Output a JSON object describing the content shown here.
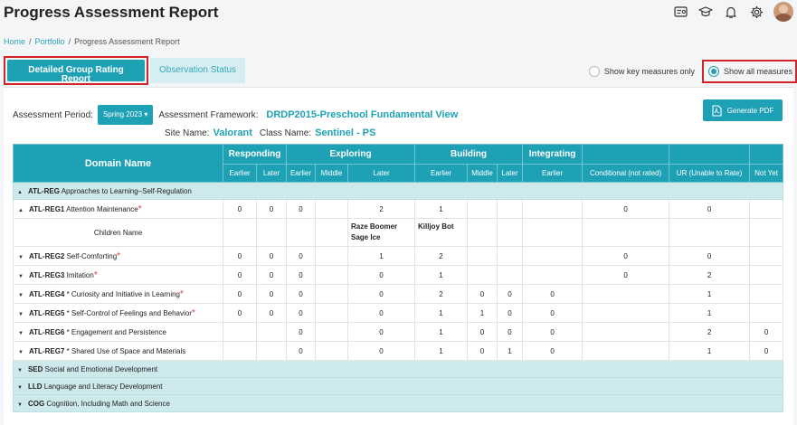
{
  "page": {
    "title": "Progress Assessment Report",
    "breadcrumb": [
      "Home",
      "Portfolio",
      "Progress Assessment Report"
    ],
    "header_icons": [
      "id-card-icon",
      "graduation-cap-icon",
      "bell-icon",
      "gear-icon"
    ]
  },
  "tabs": {
    "detailed": "Detailed Group Rating Report",
    "observation": "Observation Status"
  },
  "measures": {
    "key_only": "Show key measures only",
    "all": "Show all measures",
    "selected": "all"
  },
  "filters": {
    "period_label": "Assessment Period:",
    "period_value": "Spring 2023",
    "framework_label": "Assessment Framework:",
    "framework_value": "DRDP2015-Preschool Fundamental View",
    "site_label": "Site Name:",
    "site_value": "Valorant",
    "class_label": "Class Name:",
    "class_value": "Sentinel - PS",
    "pdf_button": "Generate PDF"
  },
  "colors": {
    "accent": "#1ea1b5",
    "highlight_box": "#d2232a",
    "required_star": "#e53935",
    "domain_row": "#cde9ec"
  },
  "table": {
    "domain_header": "Domain Name",
    "groups": [
      "Responding",
      "Exploring",
      "Building",
      "Integrating"
    ],
    "sub_headers": [
      "Earlier",
      "Later",
      "Earlier",
      "Middle",
      "Later",
      "Earlier",
      "Middle",
      "Later",
      "Earlier",
      "Conditional (not rated)",
      "UR (Unable to Rate)",
      "Not Yet"
    ],
    "domains": {
      "atl_reg": {
        "code": "ATL-REG",
        "name": "Approaches to Learning–Self-Regulation"
      },
      "sed": {
        "code": "SED",
        "name": "Social and Emotional Development"
      },
      "lld": {
        "code": "LLD",
        "name": "Language and Literacy Development"
      },
      "cog": {
        "code": "COG",
        "name": "Cognition, Including Math and Science"
      }
    },
    "children_name_label": "Children Name",
    "children_exploring_later": [
      "Raze Boomer",
      "Sage Ice"
    ],
    "children_building_earlier": [
      "Killjoy Bot"
    ],
    "rows": [
      {
        "code": "ATL-REG1",
        "name": "Attention Maintenance",
        "star": "*",
        "cells": [
          "0",
          "0",
          "0",
          "",
          "2",
          "1",
          "",
          "",
          "",
          "0",
          "0",
          ""
        ]
      },
      {
        "code": "ATL-REG2",
        "name": "Self-Comforting",
        "star": "*",
        "cells": [
          "0",
          "0",
          "0",
          "",
          "1",
          "2",
          "",
          "",
          "",
          "0",
          "0",
          ""
        ]
      },
      {
        "code": "ATL-REG3",
        "name": "Imitation",
        "star": "*",
        "cells": [
          "0",
          "0",
          "0",
          "",
          "0",
          "1",
          "",
          "",
          "",
          "0",
          "2",
          ""
        ]
      },
      {
        "code": "ATL-REG4",
        "name": "* Curiosity and Initiative in Learning",
        "star": "*",
        "cells": [
          "0",
          "0",
          "0",
          "",
          "0",
          "2",
          "0",
          "0",
          "0",
          "",
          "1",
          ""
        ]
      },
      {
        "code": "ATL-REG5",
        "name": "* Self-Control of Feelings and Behavior",
        "star": "*",
        "cells": [
          "0",
          "0",
          "0",
          "",
          "0",
          "1",
          "1",
          "0",
          "0",
          "",
          "1",
          ""
        ]
      },
      {
        "code": "ATL-REG6",
        "name": "* Engagement and Persistence",
        "star": "",
        "cells": [
          "",
          "",
          "0",
          "",
          "0",
          "1",
          "0",
          "0",
          "0",
          "",
          "2",
          "0"
        ]
      },
      {
        "code": "ATL-REG7",
        "name": "* Shared Use of Space and Materials",
        "star": "",
        "cells": [
          "",
          "",
          "0",
          "",
          "0",
          "1",
          "0",
          "1",
          "0",
          "",
          "1",
          "0"
        ]
      }
    ]
  }
}
